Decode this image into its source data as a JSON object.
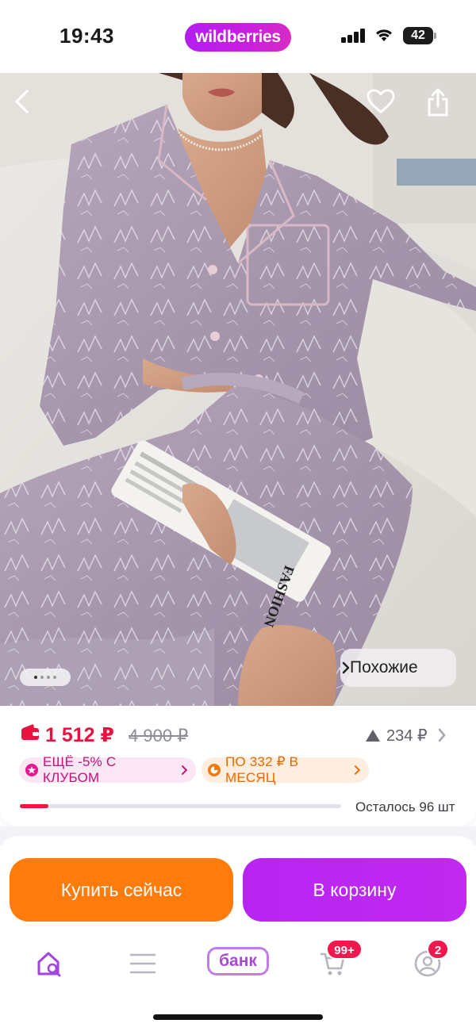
{
  "status_bar": {
    "time": "19:43",
    "brand": "wildberries",
    "battery_level": "42",
    "icons": [
      "cellular-signal-icon",
      "wifi-icon",
      "battery-icon"
    ]
  },
  "product_photo": {
    "image_description": "woman-in-lilac-satin-pajama-set-holding-magazine",
    "magazine_text": "FASHION",
    "similar_label": "Похожие",
    "gallery_dots_total": 4,
    "gallery_dot_active": 1,
    "icons": [
      "back-arrow-icon",
      "heart-icon",
      "share-icon",
      "chevron-right-icon"
    ]
  },
  "pricing": {
    "current_price": "1 512 ₽",
    "old_price": "4 900 ₽",
    "price_drop": "234 ₽",
    "club_badge": "ЕЩЁ -5% С КЛУБОМ",
    "installment_badge": "ПО 332 ₽ В МЕСЯЦ",
    "stock_text": "Осталось 96 шт",
    "stock_fraction": 0.09,
    "colors": {
      "price": "#e8123f",
      "club": "#c0137c",
      "installment": "#e86a00"
    }
  },
  "actions": {
    "buy_now": "Купить сейчас",
    "add_to_cart": "В корзину",
    "colors": {
      "buy_now": "#ff7b0c",
      "add_to_cart": "#b724f2"
    }
  },
  "tabbar": {
    "bank_label": "банк",
    "cart_count": "99+",
    "profile_count": "2",
    "icons": [
      "home-search-icon",
      "menu-icon",
      "bank-icon",
      "cart-icon",
      "profile-icon"
    ]
  }
}
